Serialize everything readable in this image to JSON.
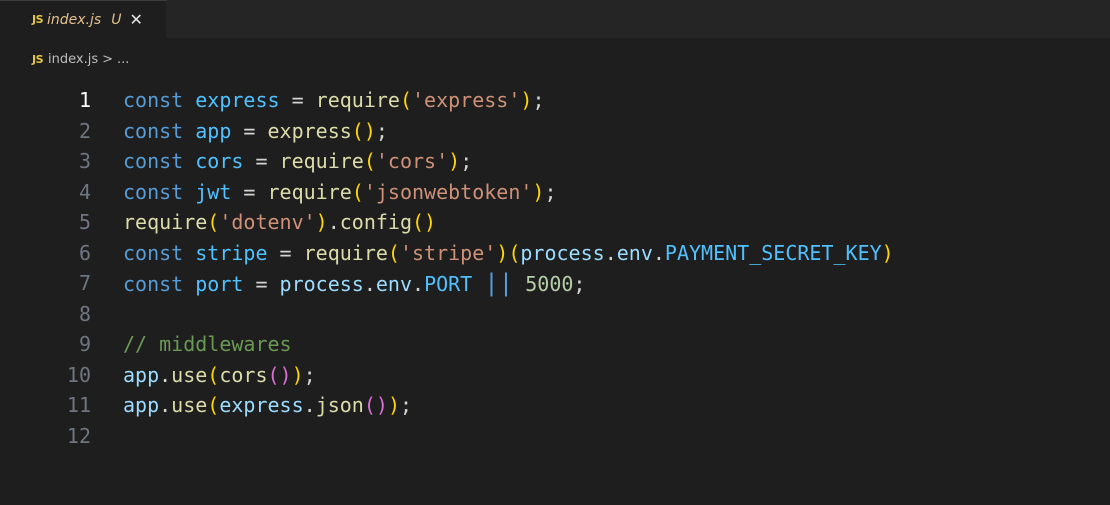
{
  "tab": {
    "badge": "JS",
    "name": "index.js",
    "status": "U",
    "close": "✕"
  },
  "breadcrumb": {
    "badge": "JS",
    "file": "index.js",
    "separator": ">",
    "tail": "..."
  },
  "editor": {
    "active_line": 1,
    "lines": [
      {
        "n": "1",
        "tokens": [
          {
            "c": "kw",
            "t": "const "
          },
          {
            "c": "cn",
            "t": "express"
          },
          {
            "c": "op",
            "t": " = "
          },
          {
            "c": "fn",
            "t": "require"
          },
          {
            "c": "b1",
            "t": "("
          },
          {
            "c": "str",
            "t": "'express'"
          },
          {
            "c": "b1",
            "t": ")"
          },
          {
            "c": "op",
            "t": ";"
          }
        ]
      },
      {
        "n": "2",
        "tokens": [
          {
            "c": "kw",
            "t": "const "
          },
          {
            "c": "cn",
            "t": "app"
          },
          {
            "c": "op",
            "t": " = "
          },
          {
            "c": "fn",
            "t": "express"
          },
          {
            "c": "b1",
            "t": "()"
          },
          {
            "c": "op",
            "t": ";"
          }
        ]
      },
      {
        "n": "3",
        "tokens": [
          {
            "c": "kw",
            "t": "const "
          },
          {
            "c": "cn",
            "t": "cors"
          },
          {
            "c": "op",
            "t": " = "
          },
          {
            "c": "fn",
            "t": "require"
          },
          {
            "c": "b1",
            "t": "("
          },
          {
            "c": "str",
            "t": "'cors'"
          },
          {
            "c": "b1",
            "t": ")"
          },
          {
            "c": "op",
            "t": ";"
          }
        ]
      },
      {
        "n": "4",
        "tokens": [
          {
            "c": "kw",
            "t": "const "
          },
          {
            "c": "cn",
            "t": "jwt"
          },
          {
            "c": "op",
            "t": " = "
          },
          {
            "c": "fn",
            "t": "require"
          },
          {
            "c": "b1",
            "t": "("
          },
          {
            "c": "str",
            "t": "'jsonwebtoken'"
          },
          {
            "c": "b1",
            "t": ")"
          },
          {
            "c": "op",
            "t": ";"
          }
        ]
      },
      {
        "n": "5",
        "tokens": [
          {
            "c": "fn",
            "t": "require"
          },
          {
            "c": "b1",
            "t": "("
          },
          {
            "c": "str",
            "t": "'dotenv'"
          },
          {
            "c": "b1",
            "t": ")"
          },
          {
            "c": "op",
            "t": "."
          },
          {
            "c": "fn",
            "t": "config"
          },
          {
            "c": "b1",
            "t": "()"
          }
        ]
      },
      {
        "n": "6",
        "tokens": [
          {
            "c": "kw",
            "t": "const "
          },
          {
            "c": "cn",
            "t": "stripe"
          },
          {
            "c": "op",
            "t": " = "
          },
          {
            "c": "fn",
            "t": "require"
          },
          {
            "c": "b1",
            "t": "("
          },
          {
            "c": "str",
            "t": "'stripe'"
          },
          {
            "c": "b1",
            "t": ")("
          },
          {
            "c": "vr",
            "t": "process"
          },
          {
            "c": "op",
            "t": "."
          },
          {
            "c": "vr",
            "t": "env"
          },
          {
            "c": "op",
            "t": "."
          },
          {
            "c": "cn",
            "t": "PAYMENT_SECRET_KEY"
          },
          {
            "c": "b1",
            "t": ")"
          }
        ]
      },
      {
        "n": "7",
        "tokens": [
          {
            "c": "kw",
            "t": "const "
          },
          {
            "c": "cn",
            "t": "port"
          },
          {
            "c": "op",
            "t": " = "
          },
          {
            "c": "vr",
            "t": "process"
          },
          {
            "c": "op",
            "t": "."
          },
          {
            "c": "vr",
            "t": "env"
          },
          {
            "c": "op",
            "t": "."
          },
          {
            "c": "cn",
            "t": "PORT"
          },
          {
            "c": "op",
            "t": " "
          },
          {
            "c": "oror",
            "t": "||"
          },
          {
            "c": "op",
            "t": " "
          },
          {
            "c": "num",
            "t": "5000"
          },
          {
            "c": "op",
            "t": ";"
          }
        ]
      },
      {
        "n": "8",
        "tokens": []
      },
      {
        "n": "9",
        "tokens": [
          {
            "c": "cm",
            "t": "// middlewares"
          }
        ]
      },
      {
        "n": "10",
        "tokens": [
          {
            "c": "vr",
            "t": "app"
          },
          {
            "c": "op",
            "t": "."
          },
          {
            "c": "fn",
            "t": "use"
          },
          {
            "c": "b1",
            "t": "("
          },
          {
            "c": "fn",
            "t": "cors"
          },
          {
            "c": "b2",
            "t": "()"
          },
          {
            "c": "b1",
            "t": ")"
          },
          {
            "c": "op",
            "t": ";"
          }
        ]
      },
      {
        "n": "11",
        "tokens": [
          {
            "c": "vr",
            "t": "app"
          },
          {
            "c": "op",
            "t": "."
          },
          {
            "c": "fn",
            "t": "use"
          },
          {
            "c": "b1",
            "t": "("
          },
          {
            "c": "vr",
            "t": "express"
          },
          {
            "c": "op",
            "t": "."
          },
          {
            "c": "fn",
            "t": "json"
          },
          {
            "c": "b2",
            "t": "()"
          },
          {
            "c": "b1",
            "t": ")"
          },
          {
            "c": "op",
            "t": ";"
          }
        ]
      },
      {
        "n": "12",
        "tokens": []
      }
    ]
  }
}
